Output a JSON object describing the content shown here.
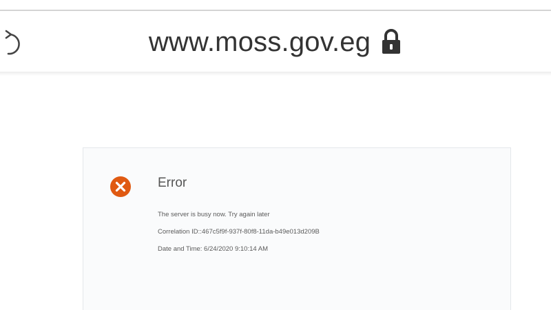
{
  "browser": {
    "url": "www.moss.gov.eg",
    "reload_icon": "reload-icon",
    "lock_icon": "lock-icon"
  },
  "error": {
    "icon": "error-x-icon",
    "icon_color": "#e05a12",
    "title": "Error",
    "message": "The server is busy now. Try again later",
    "correlation": "Correlation ID::467c5f9f-937f-80f8-11da-b49e013d209B",
    "datetime": "Date and Time: 6/24/2020 9:10:14 AM"
  }
}
